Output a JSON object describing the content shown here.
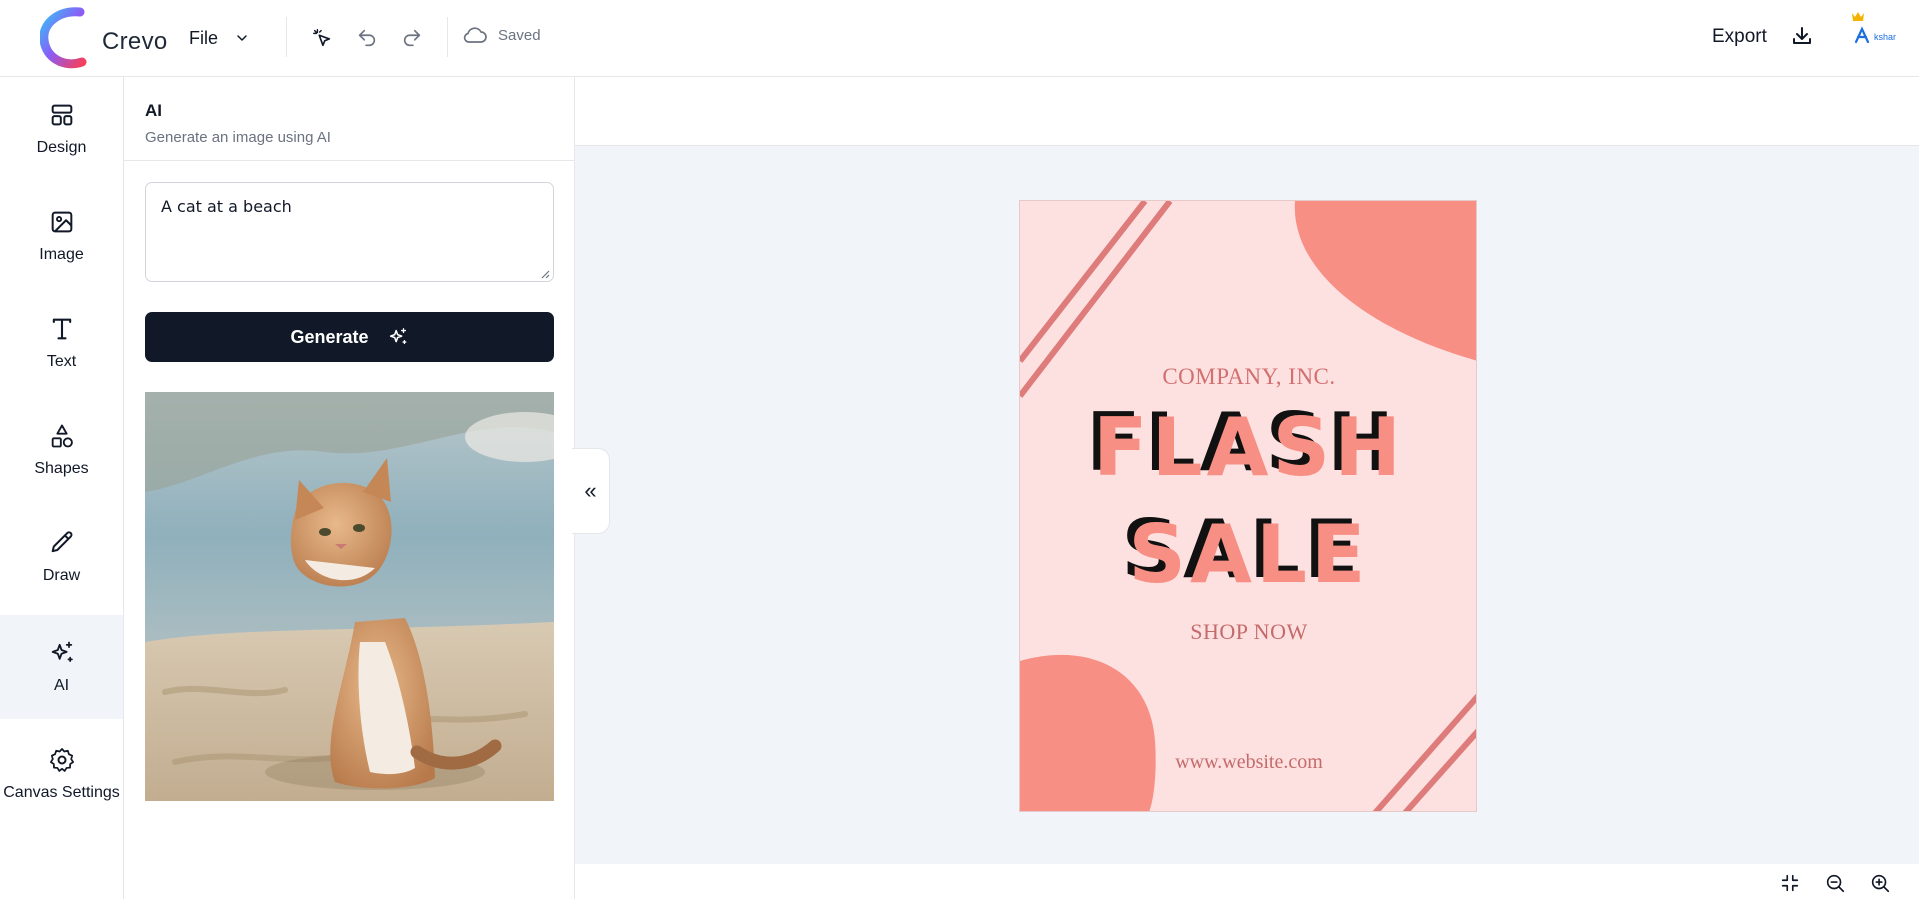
{
  "app": {
    "name": "Crevo"
  },
  "toolbar": {
    "file_label": "File",
    "saved_label": "Saved",
    "export_label": "Export",
    "user_initials": "kshar"
  },
  "nav": {
    "items": [
      {
        "label": "Design",
        "icon": "layout-icon"
      },
      {
        "label": "Image",
        "icon": "image-icon"
      },
      {
        "label": "Text",
        "icon": "text-icon"
      },
      {
        "label": "Shapes",
        "icon": "shapes-icon"
      },
      {
        "label": "Draw",
        "icon": "pencil-icon"
      },
      {
        "label": "AI",
        "icon": "sparkles-icon",
        "active": true
      },
      {
        "label": "Canvas Settings",
        "icon": "gear-icon"
      }
    ]
  },
  "panel": {
    "title": "AI",
    "subtitle": "Generate an image using AI",
    "prompt_value": "A cat at a beach",
    "generate_label": "Generate",
    "collapse_glyph": "«"
  },
  "poster": {
    "company": "COMPANY, INC.",
    "headline_1": "FLASH",
    "headline_2": "SALE",
    "cta": "SHOP NOW",
    "website": "www.website.com",
    "colors": {
      "background": "#fde1e1",
      "accent": "#f78f84",
      "stripe": "#de7b7b"
    }
  },
  "colors": {
    "primary_button": "#111827",
    "workspace": "#f1f4f8",
    "active_nav": "#f1f5f9"
  }
}
